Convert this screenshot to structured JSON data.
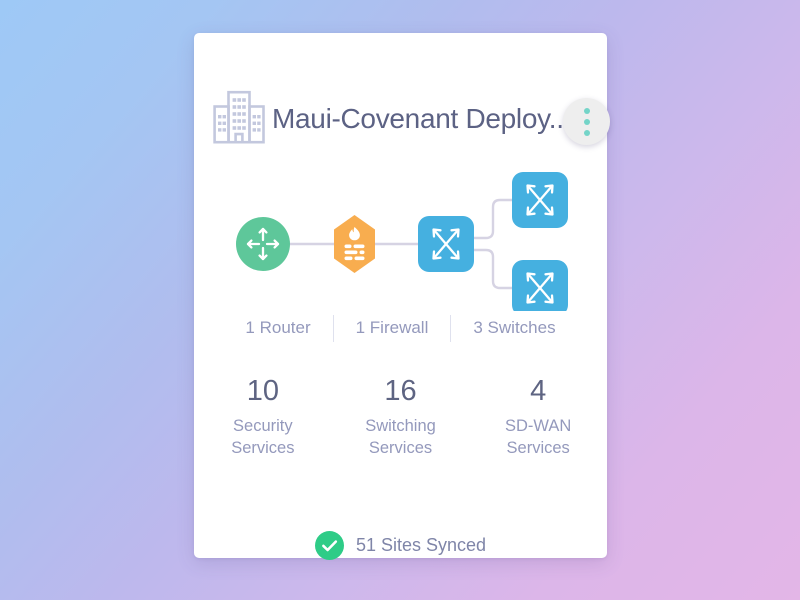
{
  "card": {
    "title": "Maui-Covenant Deploy...",
    "building_icon": "building-icon",
    "menu_icon": "more-vertical-icon"
  },
  "colors": {
    "router_green": "#5ec79a",
    "firewall_orange": "#f8ad4f",
    "switch_blue": "#45b0e0",
    "link_line": "#d6d3e3",
    "title_text": "#5c6284",
    "muted_text": "#9499bc",
    "value_text": "#5e6482",
    "sync_green": "#2ecc87",
    "menu_dot_teal": "#74d4c8",
    "card_bg": "#ffffff",
    "bg_gradient_start": "#9ec9f6",
    "bg_gradient_end": "#e3b6e7"
  },
  "topology": {
    "nodes": [
      {
        "id": "router",
        "type": "router",
        "shape": "circle",
        "icon": "router-icon",
        "color": "#5ec79a"
      },
      {
        "id": "firewall",
        "type": "firewall",
        "shape": "hexagon",
        "icon": "firewall-icon",
        "color": "#f8ad4f"
      },
      {
        "id": "switch-core",
        "type": "switch",
        "shape": "rounded-square",
        "icon": "switch-icon",
        "color": "#45b0e0"
      },
      {
        "id": "switch-top",
        "type": "switch",
        "shape": "rounded-square",
        "icon": "switch-icon",
        "color": "#45b0e0"
      },
      {
        "id": "switch-bottom",
        "type": "switch",
        "shape": "rounded-square",
        "icon": "switch-icon",
        "color": "#45b0e0"
      }
    ],
    "links": [
      {
        "from": "router",
        "to": "firewall"
      },
      {
        "from": "firewall",
        "to": "switch-core"
      },
      {
        "from": "switch-core",
        "to": "switch-top"
      },
      {
        "from": "switch-core",
        "to": "switch-bottom"
      }
    ]
  },
  "counts": [
    {
      "label": "1 Router"
    },
    {
      "label": "1 Firewall"
    },
    {
      "label": "3 Switches"
    }
  ],
  "metrics": [
    {
      "value": "10",
      "label_line1": "Security",
      "label_line2": "Services"
    },
    {
      "value": "16",
      "label_line1": "Switching",
      "label_line2": "Services"
    },
    {
      "value": "4",
      "label_line1": "SD-WAN",
      "label_line2": "Services"
    }
  ],
  "sync": {
    "icon": "check-circle-icon",
    "text": "51 Sites Synced"
  }
}
